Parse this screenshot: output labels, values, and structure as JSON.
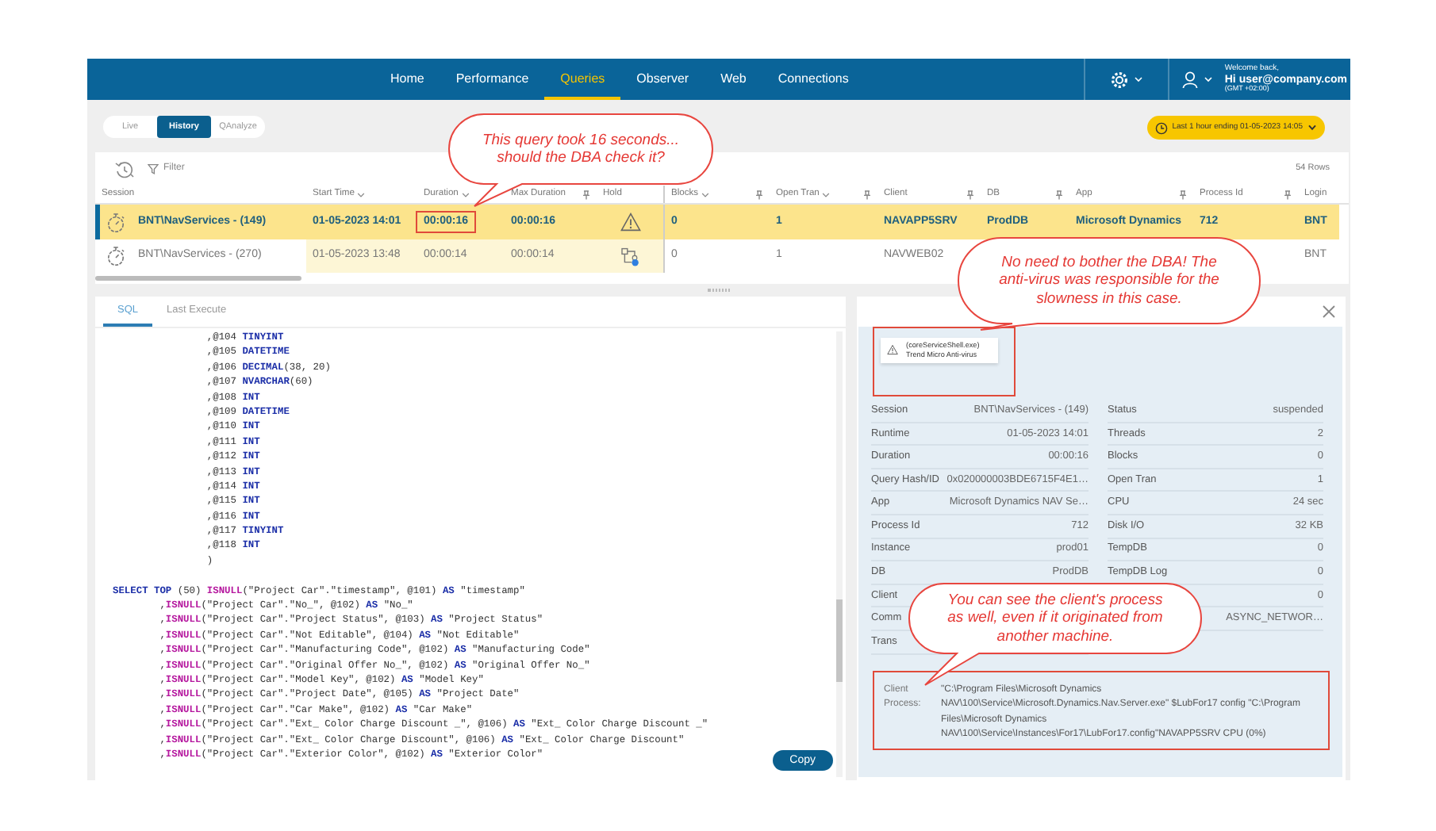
{
  "nav": {
    "items": [
      {
        "label": "Home",
        "selected": false
      },
      {
        "label": "Performance",
        "selected": false
      },
      {
        "label": "Queries",
        "selected": true
      },
      {
        "label": "Observer",
        "selected": false
      },
      {
        "label": "Web",
        "selected": false
      },
      {
        "label": "Connections",
        "selected": false
      }
    ],
    "user": {
      "greeting": "Welcome back,",
      "prefix": "Hi",
      "email": "user@company.com",
      "timezone": "(GMT +02:00)"
    }
  },
  "view_modes": [
    {
      "label": "Live",
      "selected": false
    },
    {
      "label": "History",
      "selected": true
    },
    {
      "label": "QAnalyze",
      "selected": false
    }
  ],
  "time_range": {
    "label": "Last 1 hour ending",
    "value": "01-05-2023 14:05"
  },
  "table": {
    "filter_label": "Filter",
    "row_count": "54 Rows",
    "columns": [
      {
        "label": "Session",
        "sort_icon": false,
        "pin_icon": false,
        "shaded": false
      },
      {
        "label": "Start Time",
        "sort_icon": true,
        "pin_icon": false,
        "shaded": true
      },
      {
        "label": "Duration",
        "sort_icon": true,
        "pin_icon": false,
        "shaded": true
      },
      {
        "label": "Max Duration",
        "sort_icon": false,
        "pin_icon": true,
        "shaded": true
      },
      {
        "label": "Hold",
        "sort_icon": false,
        "pin_icon": false,
        "shaded": true
      },
      {
        "label": "Blocks",
        "sort_icon": true,
        "pin_icon": true,
        "shaded": false
      },
      {
        "label": "Open Tran",
        "sort_icon": true,
        "pin_icon": true,
        "shaded": false
      },
      {
        "label": "Client",
        "sort_icon": false,
        "pin_icon": true,
        "shaded": false
      },
      {
        "label": "DB",
        "sort_icon": false,
        "pin_icon": true,
        "shaded": false
      },
      {
        "label": "App",
        "sort_icon": false,
        "pin_icon": true,
        "shaded": false
      },
      {
        "label": "Process Id",
        "sort_icon": false,
        "pin_icon": true,
        "shaded": false
      },
      {
        "label": "Login",
        "sort_icon": false,
        "pin_icon": false,
        "shaded": false
      }
    ],
    "rows": [
      {
        "selected": true,
        "session": "BNT\\NavServices - (149)",
        "start_time": "01-05-2023 14:01",
        "duration": "00:00:16",
        "duration_highlighted": true,
        "max_duration": "00:00:16",
        "hold": {
          "kind": "warning"
        },
        "blocks": "0",
        "open_tran": "1",
        "client": "NAVAPP5SRV",
        "db": "ProdDB",
        "app": "Microsoft Dynamics",
        "process_id": "712",
        "login": "BNT"
      },
      {
        "selected": false,
        "session": "BNT\\NavServices - (270)",
        "start_time": "01-05-2023 13:48",
        "duration": "00:00:14",
        "duration_highlighted": false,
        "max_duration": "00:00:14",
        "hold": {
          "kind": "hierarchy"
        },
        "blocks": "0",
        "open_tran": "1",
        "client": "NAVWEB02",
        "login": "BNT"
      }
    ]
  },
  "sql_panel": {
    "tabs": [
      {
        "label": "SQL",
        "selected": true
      },
      {
        "label": "Last Execute",
        "selected": false
      }
    ],
    "lines": [
      {
        "segs": [
          {
            "kind": "plain",
            "text": "                ,@104 "
          },
          {
            "kind": "keyword",
            "text": "TINYINT"
          }
        ]
      },
      {
        "segs": [
          {
            "kind": "plain",
            "text": "                ,@105 "
          },
          {
            "kind": "keyword",
            "text": "DATETIME"
          }
        ]
      },
      {
        "segs": [
          {
            "kind": "plain",
            "text": "                ,@106 "
          },
          {
            "kind": "keyword",
            "text": "DECIMAL"
          },
          {
            "kind": "plain",
            "text": "(38, 20)"
          }
        ]
      },
      {
        "segs": [
          {
            "kind": "plain",
            "text": "                ,@107 "
          },
          {
            "kind": "keyword",
            "text": "NVARCHAR"
          },
          {
            "kind": "plain",
            "text": "(60)"
          }
        ]
      },
      {
        "segs": [
          {
            "kind": "plain",
            "text": "                ,@108 "
          },
          {
            "kind": "keyword",
            "text": "INT"
          }
        ]
      },
      {
        "segs": [
          {
            "kind": "plain",
            "text": "                ,@109 "
          },
          {
            "kind": "keyword",
            "text": "DATETIME"
          }
        ]
      },
      {
        "segs": [
          {
            "kind": "plain",
            "text": "                ,@110 "
          },
          {
            "kind": "keyword",
            "text": "INT"
          }
        ]
      },
      {
        "segs": [
          {
            "kind": "plain",
            "text": "                ,@111 "
          },
          {
            "kind": "keyword",
            "text": "INT"
          }
        ]
      },
      {
        "segs": [
          {
            "kind": "plain",
            "text": "                ,@112 "
          },
          {
            "kind": "keyword",
            "text": "INT"
          }
        ]
      },
      {
        "segs": [
          {
            "kind": "plain",
            "text": "                ,@113 "
          },
          {
            "kind": "keyword",
            "text": "INT"
          }
        ]
      },
      {
        "segs": [
          {
            "kind": "plain",
            "text": "                ,@114 "
          },
          {
            "kind": "keyword",
            "text": "INT"
          }
        ]
      },
      {
        "segs": [
          {
            "kind": "plain",
            "text": "                ,@115 "
          },
          {
            "kind": "keyword",
            "text": "INT"
          }
        ]
      },
      {
        "segs": [
          {
            "kind": "plain",
            "text": "                ,@116 "
          },
          {
            "kind": "keyword",
            "text": "INT"
          }
        ]
      },
      {
        "segs": [
          {
            "kind": "plain",
            "text": "                ,@117 "
          },
          {
            "kind": "keyword",
            "text": "TINYINT"
          }
        ]
      },
      {
        "segs": [
          {
            "kind": "plain",
            "text": "                ,@118 "
          },
          {
            "kind": "keyword",
            "text": "INT"
          }
        ]
      },
      {
        "segs": [
          {
            "kind": "plain",
            "text": "                )"
          }
        ]
      },
      {
        "blank_before": true,
        "segs": [
          {
            "kind": "keyword",
            "text": "SELECT TOP"
          },
          {
            "kind": "plain",
            "text": " (50) "
          },
          {
            "kind": "function",
            "text": "ISNULL"
          },
          {
            "kind": "plain",
            "text": "(\"Project Car\".\"timestamp\", @101) "
          },
          {
            "kind": "keyword",
            "text": "AS"
          },
          {
            "kind": "plain",
            "text": " \"timestamp\""
          }
        ]
      },
      {
        "segs": [
          {
            "kind": "plain",
            "text": "        ,"
          },
          {
            "kind": "function",
            "text": "ISNULL"
          },
          {
            "kind": "plain",
            "text": "(\"Project Car\".\"No_\", @102) "
          },
          {
            "kind": "keyword",
            "text": "AS"
          },
          {
            "kind": "plain",
            "text": " \"No_\""
          }
        ]
      },
      {
        "segs": [
          {
            "kind": "plain",
            "text": "        ,"
          },
          {
            "kind": "function",
            "text": "ISNULL"
          },
          {
            "kind": "plain",
            "text": "(\"Project Car\".\"Project Status\", @103) "
          },
          {
            "kind": "keyword",
            "text": "AS"
          },
          {
            "kind": "plain",
            "text": " \"Project Status\""
          }
        ]
      },
      {
        "segs": [
          {
            "kind": "plain",
            "text": "        ,"
          },
          {
            "kind": "function",
            "text": "ISNULL"
          },
          {
            "kind": "plain",
            "text": "(\"Project Car\".\"Not Editable\", @104) "
          },
          {
            "kind": "keyword",
            "text": "AS"
          },
          {
            "kind": "plain",
            "text": " \"Not Editable\""
          }
        ]
      },
      {
        "segs": [
          {
            "kind": "plain",
            "text": "        ,"
          },
          {
            "kind": "function",
            "text": "ISNULL"
          },
          {
            "kind": "plain",
            "text": "(\"Project Car\".\"Manufacturing Code\", @102) "
          },
          {
            "kind": "keyword",
            "text": "AS"
          },
          {
            "kind": "plain",
            "text": " \"Manufacturing Code\""
          }
        ]
      },
      {
        "segs": [
          {
            "kind": "plain",
            "text": "        ,"
          },
          {
            "kind": "function",
            "text": "ISNULL"
          },
          {
            "kind": "plain",
            "text": "(\"Project Car\".\"Original Offer No_\", @102) "
          },
          {
            "kind": "keyword",
            "text": "AS"
          },
          {
            "kind": "plain",
            "text": " \"Original Offer No_\""
          }
        ]
      },
      {
        "segs": [
          {
            "kind": "plain",
            "text": "        ,"
          },
          {
            "kind": "function",
            "text": "ISNULL"
          },
          {
            "kind": "plain",
            "text": "(\"Project Car\".\"Model Key\", @102) "
          },
          {
            "kind": "keyword",
            "text": "AS"
          },
          {
            "kind": "plain",
            "text": " \"Model Key\""
          }
        ]
      },
      {
        "segs": [
          {
            "kind": "plain",
            "text": "        ,"
          },
          {
            "kind": "function",
            "text": "ISNULL"
          },
          {
            "kind": "plain",
            "text": "(\"Project Car\".\"Project Date\", @105) "
          },
          {
            "kind": "keyword",
            "text": "AS"
          },
          {
            "kind": "plain",
            "text": " \"Project Date\""
          }
        ]
      },
      {
        "segs": [
          {
            "kind": "plain",
            "text": "        ,"
          },
          {
            "kind": "function",
            "text": "ISNULL"
          },
          {
            "kind": "plain",
            "text": "(\"Project Car\".\"Car Make\", @102) "
          },
          {
            "kind": "keyword",
            "text": "AS"
          },
          {
            "kind": "plain",
            "text": " \"Car Make\""
          }
        ]
      },
      {
        "segs": [
          {
            "kind": "plain",
            "text": "        ,"
          },
          {
            "kind": "function",
            "text": "ISNULL"
          },
          {
            "kind": "plain",
            "text": "(\"Project Car\".\"Ext_ Color Charge Discount _\", @106) "
          },
          {
            "kind": "keyword",
            "text": "AS"
          },
          {
            "kind": "plain",
            "text": " \"Ext_ Color Charge Discount _\""
          }
        ]
      },
      {
        "segs": [
          {
            "kind": "plain",
            "text": "        ,"
          },
          {
            "kind": "function",
            "text": "ISNULL"
          },
          {
            "kind": "plain",
            "text": "(\"Project Car\".\"Ext_ Color Charge Discount\", @106) "
          },
          {
            "kind": "keyword",
            "text": "AS"
          },
          {
            "kind": "plain",
            "text": " \"Ext_ Color Charge Discount\""
          }
        ]
      },
      {
        "segs": [
          {
            "kind": "plain",
            "text": "        ,"
          },
          {
            "kind": "function",
            "text": "ISNULL"
          },
          {
            "kind": "plain",
            "text": "(\"Project Car\".\"Exterior Color\", @102) "
          },
          {
            "kind": "keyword",
            "text": "AS"
          },
          {
            "kind": "plain",
            "text": " \"Exterior Color\""
          }
        ]
      }
    ],
    "copy_label": "Copy"
  },
  "detail_panel": {
    "alert": "(coreServiceShell.exe) Trend Micro Anti-virus",
    "left_fields": [
      {
        "label": "Session",
        "value": "BNT\\NavServices - (149)"
      },
      {
        "label": "Runtime",
        "value": "01-05-2023 14:01"
      },
      {
        "label": "Duration",
        "value": "00:00:16"
      },
      {
        "label": "Query Hash/ID",
        "value": "0x020000003BDE6715F4E1…"
      },
      {
        "label": "App",
        "value": "Microsoft Dynamics NAV Se…"
      },
      {
        "label": "Process Id",
        "value": "712"
      },
      {
        "label": "Instance",
        "value": "prod01"
      },
      {
        "label": "DB",
        "value": "ProdDB"
      },
      {
        "label": "Client"
      },
      {
        "label": "Comm"
      },
      {
        "label": "Trans"
      }
    ],
    "right_fields": [
      {
        "label": "Status",
        "value": "suspended"
      },
      {
        "label": "Threads",
        "value": "2"
      },
      {
        "label": "Blocks",
        "value": "0"
      },
      {
        "label": "Open Tran",
        "value": "1"
      },
      {
        "label": "CPU",
        "value": "24 sec"
      },
      {
        "label": "Disk I/O",
        "value": "32 KB"
      },
      {
        "label": "TempDB",
        "value": "0"
      },
      {
        "label": "TempDB Log",
        "value": "0"
      },
      {
        "value": "0"
      },
      {
        "value": "ASYNC_NETWOR…"
      }
    ],
    "client_process": {
      "label": "Client Process:",
      "value": "\"C:\\Program Files\\Microsoft Dynamics NAV\\100\\Service\\Microsoft.Dynamics.Nav.Server.exe\" $LubFor17 config \"C:\\Program Files\\Microsoft Dynamics NAV\\100\\Service\\Instances\\For17\\LubFor17.config\"NAVAPP5SRV CPU  (0%)"
    }
  },
  "callouts": [
    {
      "text": "This query took 16 seconds... should the DBA check it?"
    },
    {
      "text": "No need to bother the DBA! The anti-virus was responsible for the slowness in this case."
    },
    {
      "text": "You can see the client's process as well, even if it originated from another machine."
    }
  ]
}
